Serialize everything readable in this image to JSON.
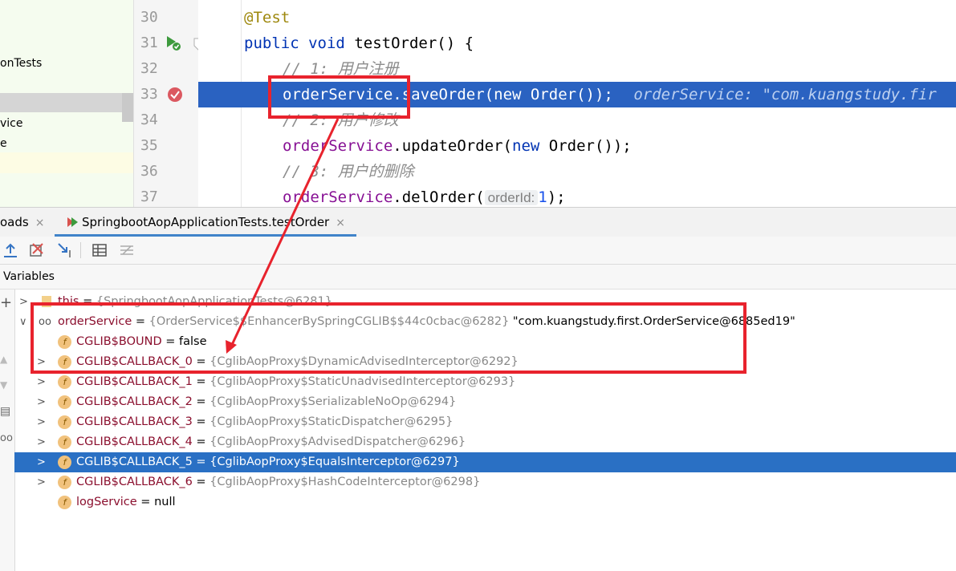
{
  "project_tree": {
    "row1": "onTests",
    "row2": "vice",
    "row3": "e"
  },
  "gutter": {
    "lines": [
      "30",
      "31",
      "32",
      "33",
      "34",
      "35",
      "36",
      "37"
    ]
  },
  "editor": {
    "l30": "@Test",
    "l31_kw1": "public",
    "l31_kw2": "void",
    "l31_rest": "testOrder() {",
    "l32": "// 1: 用户注册",
    "l33_code1": "orderService",
    "l33_code2": ".saveOrder(",
    "l33_kw": "new",
    "l33_code3": "Order());",
    "l33_debug": "orderService: \"com.kuangstudy.fir",
    "l34": "// 2: 用户修改",
    "l35_fld": "orderService",
    "l35_mid": ".updateOrder(",
    "l35_kw": "new",
    "l35_end": "Order());",
    "l36": "// 3: 用户的删除",
    "l37_fld": "orderService",
    "l37_mid": ".delOrder(",
    "l37_hint": "orderId:",
    "l37_num": "1",
    "l37_end": ");"
  },
  "tabs": {
    "tab1": "oads",
    "tab2": "SpringbootAopApplicationTests.testOrder",
    "close": "×"
  },
  "variables_header": "Variables",
  "variables": [
    {
      "name": "this",
      "eq": " = ",
      "val": "{SpringbootAopApplicationTests@6281}",
      "text": ""
    },
    {
      "name": "orderService",
      "eq": " = ",
      "val": "{OrderService$$EnhancerBySpringCGLIB$$44c0cbac@6282}",
      "text": " \"com.kuangstudy.first.OrderService@6885ed19\""
    },
    {
      "name": "CGLIB$BOUND",
      "eq": " = ",
      "val": "",
      "text": "false"
    },
    {
      "name": "CGLIB$CALLBACK_0",
      "eq": " = ",
      "val": "{CglibAopProxy$DynamicAdvisedInterceptor@6292}",
      "text": ""
    },
    {
      "name": "CGLIB$CALLBACK_1",
      "eq": " = ",
      "val": "{CglibAopProxy$StaticUnadvisedInterceptor@6293}",
      "text": ""
    },
    {
      "name": "CGLIB$CALLBACK_2",
      "eq": " = ",
      "val": "{CglibAopProxy$SerializableNoOp@6294}",
      "text": ""
    },
    {
      "name": "CGLIB$CALLBACK_3",
      "eq": " = ",
      "val": "{CglibAopProxy$StaticDispatcher@6295}",
      "text": ""
    },
    {
      "name": "CGLIB$CALLBACK_4",
      "eq": " = ",
      "val": "{CglibAopProxy$AdvisedDispatcher@6296}",
      "text": ""
    },
    {
      "name": "CGLIB$CALLBACK_5",
      "eq": " = ",
      "val": "{CglibAopProxy$EqualsInterceptor@6297}",
      "text": ""
    },
    {
      "name": "CGLIB$CALLBACK_6",
      "eq": " = ",
      "val": "{CglibAopProxy$HashCodeInterceptor@6298}",
      "text": ""
    },
    {
      "name": "logService",
      "eq": " = ",
      "val": "",
      "text": "null"
    }
  ],
  "field_icon_letter": "f",
  "colors": {
    "exec_line": "#2a62c1",
    "selected_row": "#2a70c4",
    "annotation_red": "#e8232d"
  }
}
